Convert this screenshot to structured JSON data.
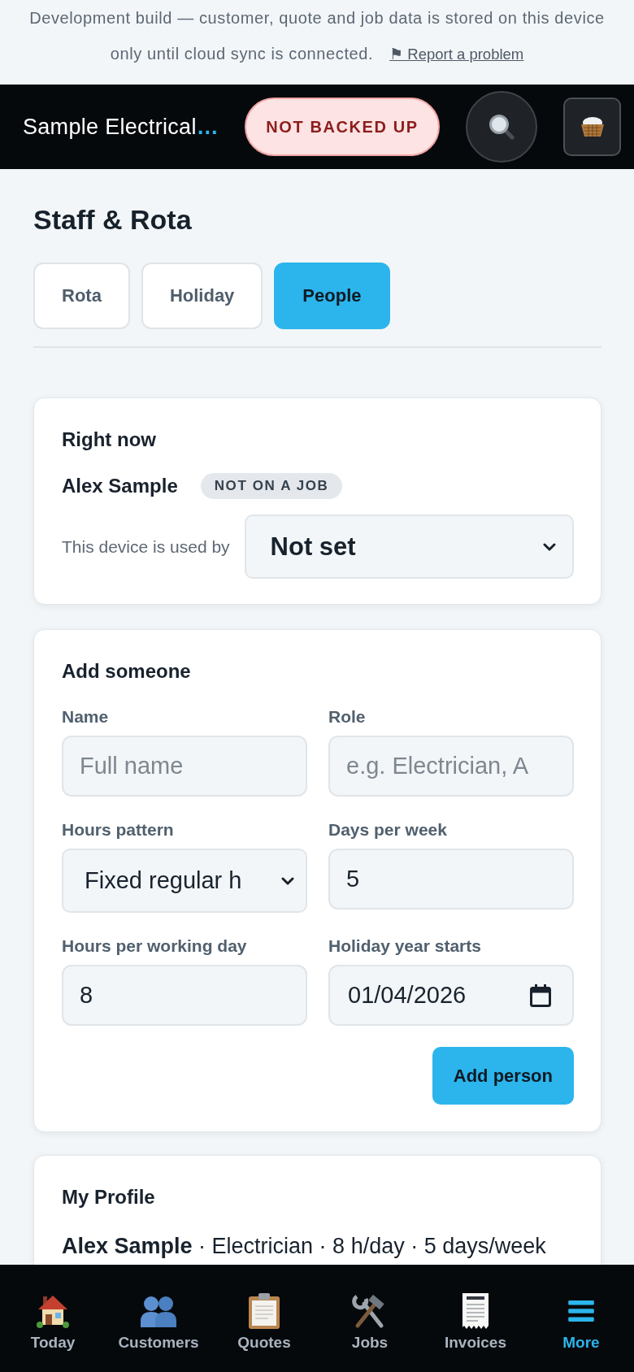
{
  "notice": {
    "text": "Development build — customer, quote and job data is stored on this device only until cloud sync is connected.",
    "link": "⚑ Report a problem"
  },
  "header": {
    "business_name": "Sample Electrical",
    "overflow_mark": "…",
    "backup_status": "NOT BACKED UP"
  },
  "page": {
    "title": "Staff & Rota"
  },
  "tabs": [
    {
      "label": "Rota",
      "selected": false
    },
    {
      "label": "Holiday",
      "selected": false
    },
    {
      "label": "People",
      "selected": true
    }
  ],
  "right_now": {
    "title": "Right now",
    "person": "Alex Sample",
    "status": "NOT ON A JOB",
    "device_label": "This device is used by",
    "device_user": "Not set"
  },
  "add_someone": {
    "title": "Add someone",
    "fields": [
      {
        "kind": "text",
        "label": "Name",
        "placeholder": "Full name"
      },
      {
        "kind": "text",
        "label": "Role",
        "placeholder": "e.g. Electrician, A"
      },
      {
        "kind": "select",
        "label": "Hours pattern",
        "value": "Fixed regular h"
      },
      {
        "kind": "text",
        "label": "Days per week",
        "value": "5"
      },
      {
        "kind": "text",
        "label": "Hours per working day",
        "value": "8"
      },
      {
        "kind": "date",
        "label": "Holiday year starts",
        "value": "01/04/2026"
      }
    ],
    "button": "Add person"
  },
  "my_profile": {
    "title": "My Profile",
    "summary": "**Alex Sample** · Electrician · 8 h/day · 5 days/week"
  },
  "bottom_nav": [
    {
      "label": "Today",
      "selected": false
    },
    {
      "label": "Customers",
      "selected": false
    },
    {
      "label": "Quotes",
      "selected": false
    },
    {
      "label": "Jobs",
      "selected": false
    },
    {
      "label": "Invoices",
      "selected": false
    },
    {
      "label": "More",
      "selected": true
    }
  ]
}
